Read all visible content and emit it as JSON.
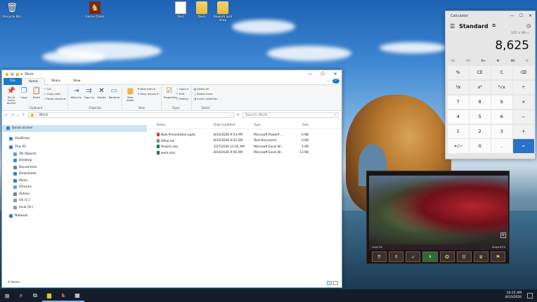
{
  "desktop": {
    "icons": [
      {
        "label": "Recycle Bin"
      },
      {
        "label": "Game Client"
      },
      {
        "label": "Text"
      },
      {
        "label": "Docs"
      },
      {
        "label": "Rework and shop"
      }
    ]
  },
  "explorer": {
    "title": "Work",
    "tabs": [
      "File",
      "Home",
      "Share",
      "View"
    ],
    "ribbon": {
      "clipboard": {
        "label": "Clipboard",
        "pin": "Pin to Quick access",
        "copy": "Copy",
        "paste": "Paste",
        "cut": "Cut",
        "copy_path": "Copy path",
        "paste_shortcut": "Paste shortcut"
      },
      "organize": {
        "label": "Organize",
        "move_to": "Move to",
        "copy_to": "Copy to",
        "delete": "Delete",
        "rename": "Rename"
      },
      "new": {
        "label": "New",
        "new_folder": "New folder",
        "new_item": "New item",
        "easy_access": "Easy access"
      },
      "open": {
        "label": "Open",
        "properties": "Properties",
        "open": "Open",
        "edit": "Edit",
        "history": "History"
      },
      "select": {
        "label": "Select",
        "select_all": "Select all",
        "select_none": "Select none",
        "invert": "Invert selection"
      }
    },
    "address": "Work",
    "search_placeholder": "Search Work",
    "nav": [
      {
        "label": "Quick access",
        "color": "#3a7bc8"
      },
      {
        "label": "OneDrive",
        "color": "#2e88d8"
      },
      {
        "label": "This PC",
        "color": "#3a7bc8"
      },
      {
        "label": "3D Objects",
        "color": "#4aa0e6"
      },
      {
        "label": "Desktop",
        "color": "#2e88d8"
      },
      {
        "label": "Documents",
        "color": "#6a7f99"
      },
      {
        "label": "Downloads",
        "color": "#2e88d8"
      },
      {
        "label": "Music",
        "color": "#3a7bc8"
      },
      {
        "label": "Pictures",
        "color": "#5fa6d6"
      },
      {
        "label": "Videos",
        "color": "#6a7f99"
      },
      {
        "label": "OS (C:)",
        "color": "#8a9bb0"
      },
      {
        "label": "local (D:)",
        "color": "#8a9bb0"
      },
      {
        "label": "Network",
        "color": "#3a7bc8"
      }
    ],
    "columns": [
      "Name",
      "Date modified",
      "Type",
      "Size"
    ],
    "files": [
      {
        "name": "New Presentation.pptx",
        "date": "8/10/2026 9:53 AM",
        "type": "Microsoft PowerP...",
        "size": "0 KB",
        "color": "#c9482b"
      },
      {
        "name": "Other.txt",
        "date": "8/10/2026 9:52 AM",
        "type": "Text Document",
        "size": "0 KB",
        "color": "#7d8aa0"
      },
      {
        "name": "Project.xlsx",
        "date": "5/27/2026 11:05 AM",
        "type": "Microsoft Excel W...",
        "size": "5 KB",
        "color": "#1f7a43"
      },
      {
        "name": "work.xlsx",
        "date": "8/10/2026 9:56 AM",
        "type": "Microsoft Excel W...",
        "size": "13 KB",
        "color": "#1f7a43"
      }
    ],
    "status": "4 items"
  },
  "calculator": {
    "title": "Calculator",
    "mode": "Standard",
    "expression": "125 × 69 =",
    "display": "8,625",
    "memory": [
      "MC",
      "MR",
      "M+",
      "M-",
      "MS",
      "M˅"
    ],
    "keys": [
      "%",
      "CE",
      "C",
      "⌫",
      "⅟x",
      "x²",
      "²√x",
      "÷",
      "7",
      "8",
      "9",
      "×",
      "4",
      "5",
      "6",
      "−",
      "1",
      "2",
      "3",
      "+",
      "+/−",
      "0",
      ".",
      "="
    ]
  },
  "game": {
    "level": "Level 84",
    "stage": "Stage 6/10",
    "slots": [
      "⇈",
      "⚱",
      "➶",
      "⬧",
      "✪",
      "☰",
      "♛",
      "⚑"
    ]
  },
  "taskbar": {
    "time": "10:25 AM",
    "date": "8/10/2026"
  }
}
